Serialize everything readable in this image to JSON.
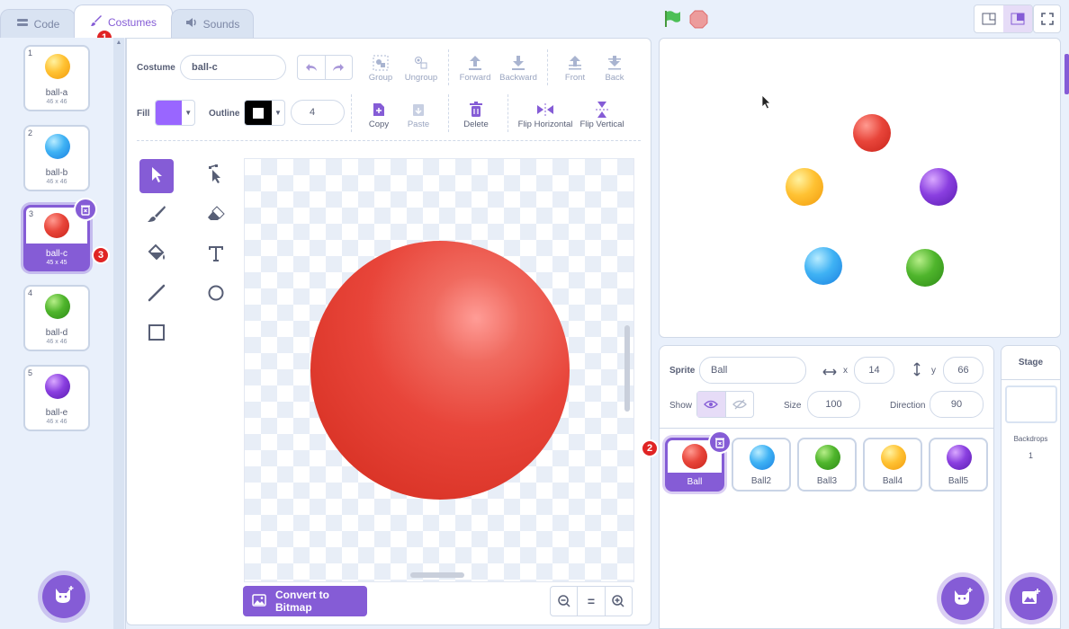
{
  "tabs": [
    {
      "label": "Code",
      "icon": "code-icon"
    },
    {
      "label": "Costumes",
      "icon": "brush-icon"
    },
    {
      "label": "Sounds",
      "icon": "speaker-icon"
    }
  ],
  "badges": {
    "b1": "1",
    "b2": "2",
    "b3": "3"
  },
  "costumes": [
    {
      "num": "1",
      "name": "ball-a",
      "dim": "46 x 46",
      "color": "yellow"
    },
    {
      "num": "2",
      "name": "ball-b",
      "dim": "46 x 46",
      "color": "blue"
    },
    {
      "num": "3",
      "name": "ball-c",
      "dim": "45 x 45",
      "color": "red"
    },
    {
      "num": "4",
      "name": "ball-d",
      "dim": "46 x 46",
      "color": "green"
    },
    {
      "num": "5",
      "name": "ball-e",
      "dim": "46 x 46",
      "color": "purple"
    }
  ],
  "editor": {
    "costume_label": "Costume",
    "costume_name": "ball-c",
    "fill_label": "Fill",
    "outline_label": "Outline",
    "outline_width": "4",
    "fill_color": "#9966ff",
    "outline_color": "#000000",
    "tools_top": {
      "group": "Group",
      "ungroup": "Ungroup",
      "forward": "Forward",
      "backward": "Backward",
      "front": "Front",
      "back": "Back"
    },
    "tools_bottom": {
      "copy": "Copy",
      "paste": "Paste",
      "delete": "Delete",
      "flip_h": "Flip Horizontal",
      "flip_v": "Flip Vertical"
    },
    "convert_label": "Convert to Bitmap",
    "zoom_reset": "="
  },
  "sprite_info": {
    "sprite_label": "Sprite",
    "sprite_name": "Ball",
    "x_label": "x",
    "x_value": "14",
    "y_label": "y",
    "y_value": "66",
    "show_label": "Show",
    "size_label": "Size",
    "size_value": "100",
    "direction_label": "Direction",
    "direction_value": "90"
  },
  "sprites": [
    {
      "name": "Ball",
      "color": "red"
    },
    {
      "name": "Ball2",
      "color": "blue"
    },
    {
      "name": "Ball3",
      "color": "green"
    },
    {
      "name": "Ball4",
      "color": "yellow"
    },
    {
      "name": "Ball5",
      "color": "purple"
    }
  ],
  "stage_panel": {
    "title": "Stage",
    "backdrops_label": "Backdrops",
    "backdrops_count": "1"
  },
  "colors": {
    "accent": "#855cd6",
    "badge": "#e02424"
  }
}
